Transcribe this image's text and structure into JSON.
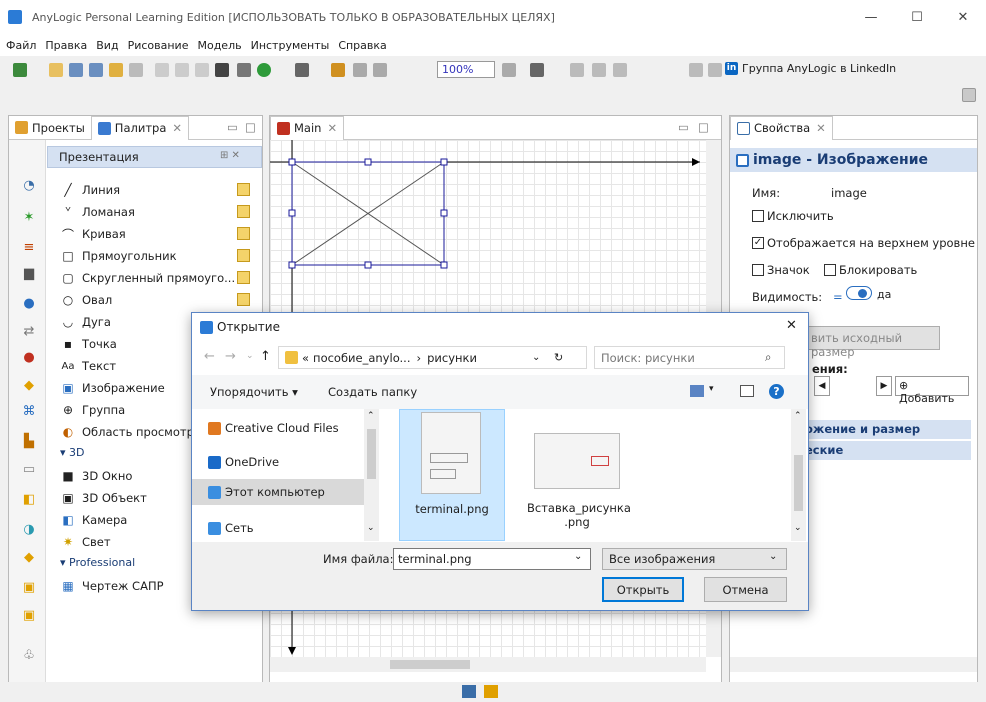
{
  "window": {
    "title": "AnyLogic Personal Learning Edition [ИСПОЛЬЗОВАТЬ ТОЛЬКО В ОБРАЗОВАТЕЛЬНЫХ ЦЕЛЯХ]",
    "min": "—",
    "max": "☐",
    "close": "✕"
  },
  "menu": [
    "Файл",
    "Правка",
    "Вид",
    "Рисование",
    "Модель",
    "Инструменты",
    "Справка"
  ],
  "toolbar": {
    "zoom": "100%",
    "linkedin_text": "Группа AnyLogic в LinkedIn",
    "linkedin_badge": "in"
  },
  "left_panel": {
    "tab_projects": "Проекты",
    "tab_palette": "Палитра",
    "section": "Презентация",
    "items": [
      {
        "glyph": "╱",
        "label": "Линия"
      },
      {
        "glyph": "ᘁ",
        "label": "Ломаная"
      },
      {
        "glyph": "⌒",
        "label": "Кривая"
      },
      {
        "glyph": "□",
        "label": "Прямоугольник"
      },
      {
        "glyph": "▢",
        "label": "Скругленный прямоуго..."
      },
      {
        "glyph": "○",
        "label": "Овал"
      },
      {
        "glyph": "◡",
        "label": "Дуга"
      },
      {
        "glyph": "▪",
        "label": "Точка"
      },
      {
        "glyph": "Aa",
        "label": "Текст"
      },
      {
        "glyph": "▣",
        "label": "Изображение"
      },
      {
        "glyph": "⊕",
        "label": "Группа"
      },
      {
        "glyph": "◐",
        "label": "Область просмотра"
      }
    ],
    "section_3d": "3D",
    "items_3d": [
      {
        "glyph": "■",
        "label": "3D Окно"
      },
      {
        "glyph": "▣",
        "label": "3D Объект"
      },
      {
        "glyph": "◧",
        "label": "Камера"
      },
      {
        "glyph": "✷",
        "label": "Свет"
      }
    ],
    "section_pro": "Professional",
    "items_pro": [
      {
        "glyph": "▦",
        "label": "Чертеж САПР"
      }
    ]
  },
  "center_panel": {
    "tab": "Main"
  },
  "right_panel": {
    "tab": "Свойства",
    "header": "image - Изображение",
    "name_label": "Имя:",
    "name_value": "image",
    "exclude": "Исключить",
    "top_level": "Отображается на верхнем уровне",
    "icon": "Значок",
    "lock": "Блокировать",
    "visibility_label": "Видимость:",
    "visibility_value": "да",
    "orig_size": "вить исходный размер",
    "images_label": "ения:",
    "add_btn": "Добавить",
    "sec_position": "ожение и размер",
    "sec_specific": "еские"
  },
  "dialog": {
    "title": "Открытие",
    "path_prefix": "«",
    "path_1": "пособие_anylo...",
    "path_sep": "›",
    "path_2": "рисунки",
    "search_placeholder": "Поиск: рисунки",
    "organize": "Упорядочить ▾",
    "new_folder": "Создать папку",
    "nav": [
      {
        "label": "Creative Cloud Files"
      },
      {
        "label": "OneDrive"
      },
      {
        "label": "Этот компьютер"
      },
      {
        "label": "Сеть"
      }
    ],
    "files": [
      {
        "name": "terminal.png"
      },
      {
        "name": "Вставка_рисунка\n.png"
      }
    ],
    "filename_label": "Имя файла:",
    "filename_value": "terminal.png",
    "filter": "Все изображения",
    "open_btn": "Открыть",
    "cancel_btn": "Отмена"
  },
  "colors": {
    "accent": "#0078d7",
    "selection": "#cce8ff",
    "anylogic_blue": "#1a5fb4"
  }
}
